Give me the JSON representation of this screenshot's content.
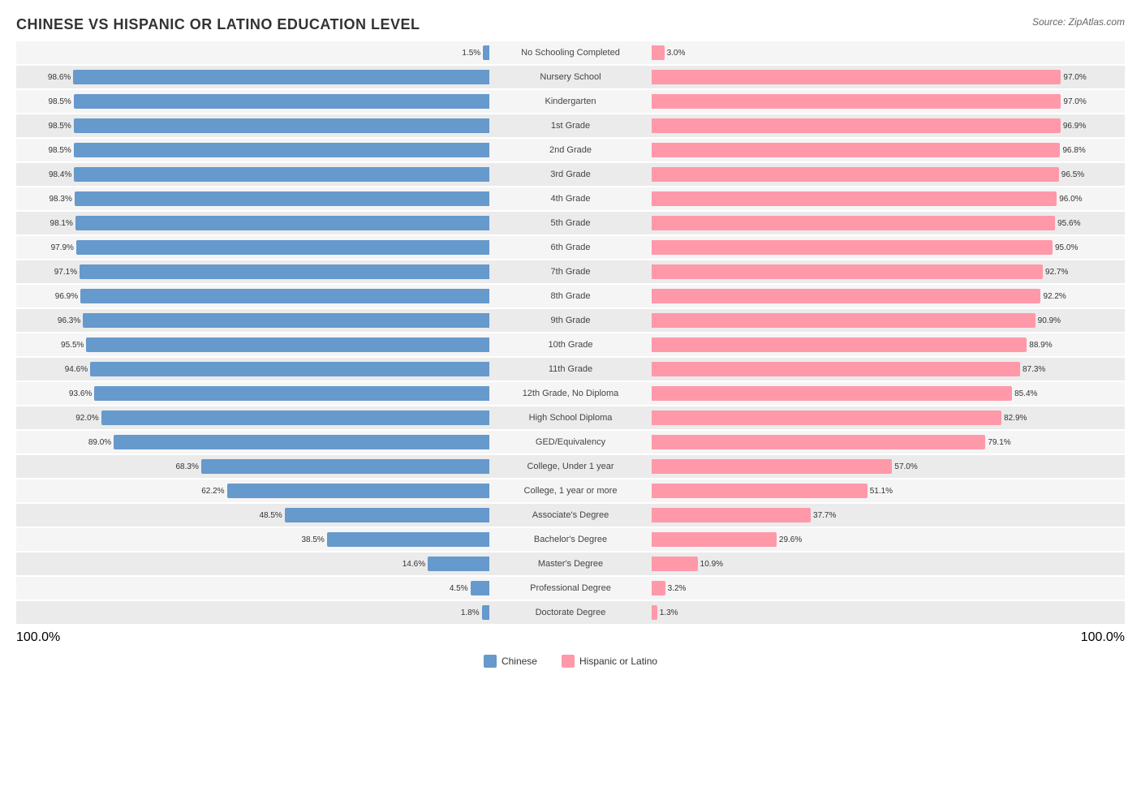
{
  "chart": {
    "title": "CHINESE VS HISPANIC OR LATINO EDUCATION LEVEL",
    "source": "Source: ZipAtlas.com",
    "left_label": "100.0%",
    "right_label": "100.0%",
    "legend": {
      "chinese_label": "Chinese",
      "hispanic_label": "Hispanic or Latino"
    },
    "rows": [
      {
        "label": "No Schooling Completed",
        "left_val": "1.5%",
        "left_pct": 1.5,
        "right_val": "3.0%",
        "right_pct": 3.0
      },
      {
        "label": "Nursery School",
        "left_val": "98.6%",
        "left_pct": 98.6,
        "right_val": "97.0%",
        "right_pct": 97.0
      },
      {
        "label": "Kindergarten",
        "left_val": "98.5%",
        "left_pct": 98.5,
        "right_val": "97.0%",
        "right_pct": 97.0
      },
      {
        "label": "1st Grade",
        "left_val": "98.5%",
        "left_pct": 98.5,
        "right_val": "96.9%",
        "right_pct": 96.9
      },
      {
        "label": "2nd Grade",
        "left_val": "98.5%",
        "left_pct": 98.5,
        "right_val": "96.8%",
        "right_pct": 96.8
      },
      {
        "label": "3rd Grade",
        "left_val": "98.4%",
        "left_pct": 98.4,
        "right_val": "96.5%",
        "right_pct": 96.5
      },
      {
        "label": "4th Grade",
        "left_val": "98.3%",
        "left_pct": 98.3,
        "right_val": "96.0%",
        "right_pct": 96.0
      },
      {
        "label": "5th Grade",
        "left_val": "98.1%",
        "left_pct": 98.1,
        "right_val": "95.6%",
        "right_pct": 95.6
      },
      {
        "label": "6th Grade",
        "left_val": "97.9%",
        "left_pct": 97.9,
        "right_val": "95.0%",
        "right_pct": 95.0
      },
      {
        "label": "7th Grade",
        "left_val": "97.1%",
        "left_pct": 97.1,
        "right_val": "92.7%",
        "right_pct": 92.7
      },
      {
        "label": "8th Grade",
        "left_val": "96.9%",
        "left_pct": 96.9,
        "right_val": "92.2%",
        "right_pct": 92.2
      },
      {
        "label": "9th Grade",
        "left_val": "96.3%",
        "left_pct": 96.3,
        "right_val": "90.9%",
        "right_pct": 90.9
      },
      {
        "label": "10th Grade",
        "left_val": "95.5%",
        "left_pct": 95.5,
        "right_val": "88.9%",
        "right_pct": 88.9
      },
      {
        "label": "11th Grade",
        "left_val": "94.6%",
        "left_pct": 94.6,
        "right_val": "87.3%",
        "right_pct": 87.3
      },
      {
        "label": "12th Grade, No Diploma",
        "left_val": "93.6%",
        "left_pct": 93.6,
        "right_val": "85.4%",
        "right_pct": 85.4
      },
      {
        "label": "High School Diploma",
        "left_val": "92.0%",
        "left_pct": 92.0,
        "right_val": "82.9%",
        "right_pct": 82.9
      },
      {
        "label": "GED/Equivalency",
        "left_val": "89.0%",
        "left_pct": 89.0,
        "right_val": "79.1%",
        "right_pct": 79.1
      },
      {
        "label": "College, Under 1 year",
        "left_val": "68.3%",
        "left_pct": 68.3,
        "right_val": "57.0%",
        "right_pct": 57.0
      },
      {
        "label": "College, 1 year or more",
        "left_val": "62.2%",
        "left_pct": 62.2,
        "right_val": "51.1%",
        "right_pct": 51.1
      },
      {
        "label": "Associate's Degree",
        "left_val": "48.5%",
        "left_pct": 48.5,
        "right_val": "37.7%",
        "right_pct": 37.7
      },
      {
        "label": "Bachelor's Degree",
        "left_val": "38.5%",
        "left_pct": 38.5,
        "right_val": "29.6%",
        "right_pct": 29.6
      },
      {
        "label": "Master's Degree",
        "left_val": "14.6%",
        "left_pct": 14.6,
        "right_val": "10.9%",
        "right_pct": 10.9
      },
      {
        "label": "Professional Degree",
        "left_val": "4.5%",
        "left_pct": 4.5,
        "right_val": "3.2%",
        "right_pct": 3.2
      },
      {
        "label": "Doctorate Degree",
        "left_val": "1.8%",
        "left_pct": 1.8,
        "right_val": "1.3%",
        "right_pct": 1.3
      }
    ]
  }
}
